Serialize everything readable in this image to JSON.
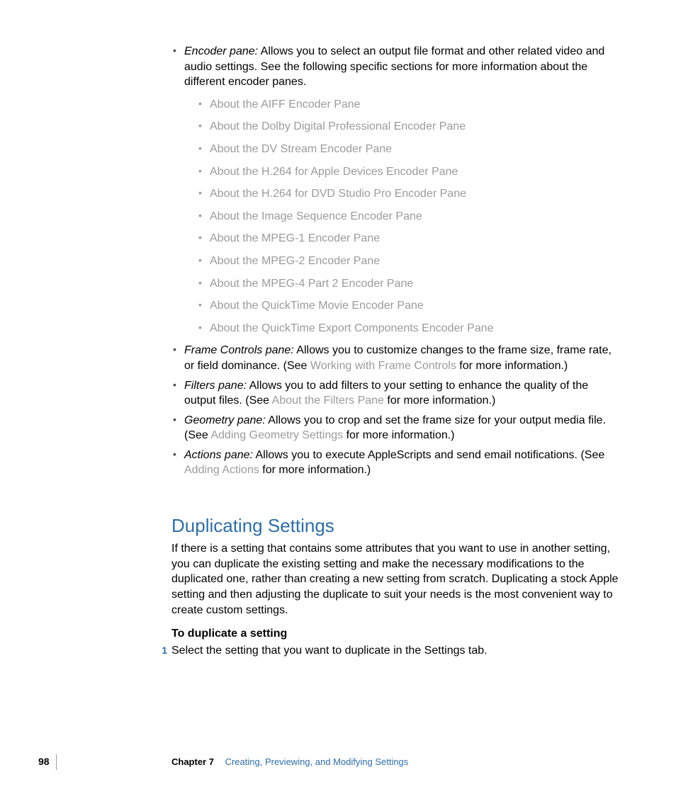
{
  "panes": {
    "encoder": {
      "term": "Encoder pane:",
      "desc_before": "  Allows you to select an output file format and other related video and audio settings. See the following specific sections for more information about the different encoder panes.",
      "links": [
        "About the AIFF Encoder Pane",
        "About the Dolby Digital Professional Encoder Pane",
        "About the DV Stream Encoder Pane",
        "About the H.264 for Apple Devices Encoder Pane",
        "About the H.264 for DVD Studio Pro Encoder Pane",
        "About the Image Sequence Encoder Pane",
        "About the MPEG-1 Encoder Pane",
        "About the MPEG-2 Encoder Pane",
        "About the MPEG-4 Part 2 Encoder Pane",
        "About the QuickTime Movie Encoder Pane",
        "About the QuickTime Export Components Encoder Pane"
      ]
    },
    "frame": {
      "term": "Frame Controls pane:",
      "before": "  Allows you to customize changes to the frame size, frame rate, or field dominance. (See ",
      "link": "Working with Frame Controls",
      "after": " for more information.)"
    },
    "filters": {
      "term": "Filters pane:",
      "before": "  Allows you to add filters to your setting to enhance the quality of the output files. (See ",
      "link": "About the Filters Pane",
      "after": " for more information.)"
    },
    "geometry": {
      "term": "Geometry pane:",
      "before": "  Allows you to crop and set the frame size for your output media file. (See ",
      "link": "Adding Geometry Settings",
      "after": " for more information.)"
    },
    "actions": {
      "term": "Actions pane:",
      "before": "  Allows you to execute AppleScripts and send email notifications. (See ",
      "link": "Adding Actions",
      "after": " for more information.)"
    }
  },
  "section": {
    "title": "Duplicating Settings",
    "body": "If there is a setting that contains some attributes that you want to use in another setting, you can duplicate the existing setting and make the necessary modifications to the duplicated one, rather than creating a new setting from scratch. Duplicating a stock Apple setting and then adjusting the duplicate to suit your needs is the most convenient way to create custom settings.",
    "subhead": "To duplicate a setting",
    "step_num": "1",
    "step_text": "Select the setting that you want to duplicate in the Settings tab."
  },
  "footer": {
    "page": "98",
    "chapter_label": "Chapter 7",
    "chapter_title": "Creating, Previewing, and Modifying Settings"
  }
}
